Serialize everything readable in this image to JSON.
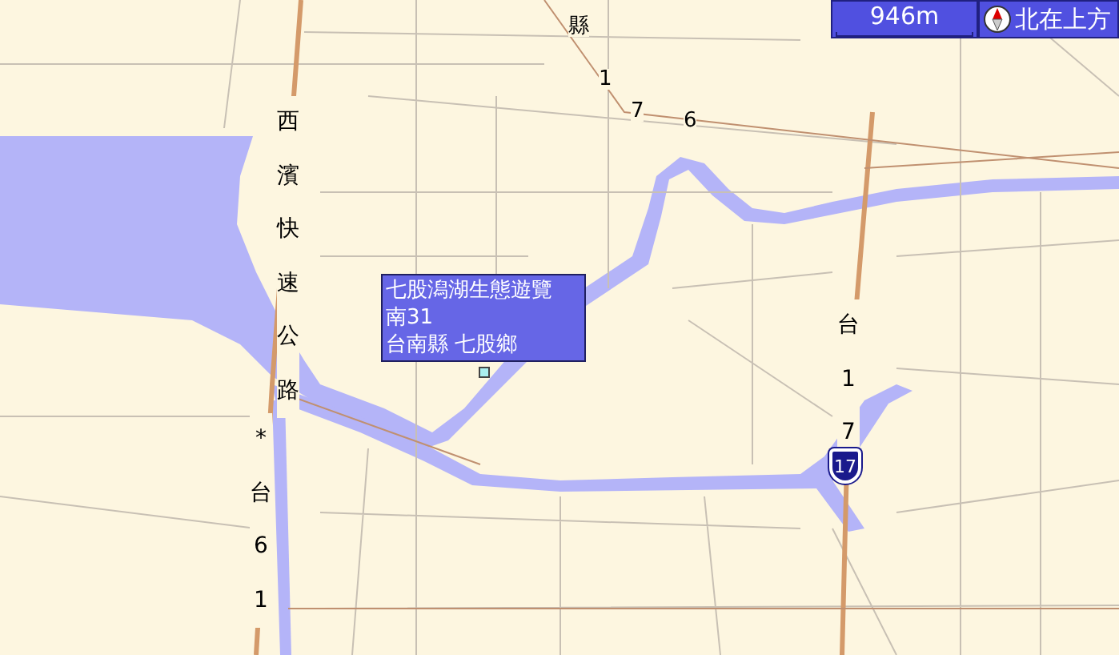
{
  "scale": {
    "distance": "946m"
  },
  "orientation": {
    "label": "北在上方"
  },
  "poi_card": {
    "lines": [
      "七股潟湖生態遊覽",
      "南31",
      "台南縣 七股鄉"
    ]
  },
  "map_labels": [
    {
      "kind": "vertical",
      "text": "西濱快速公路"
    },
    {
      "kind": "vertical",
      "text": "*台61"
    },
    {
      "kind": "text",
      "text": "縣"
    },
    {
      "kind": "text",
      "text": "1"
    },
    {
      "kind": "text",
      "text": "7"
    },
    {
      "kind": "text",
      "text": "6"
    },
    {
      "kind": "vertical",
      "text": "台17"
    },
    {
      "kind": "shield",
      "text": "17"
    }
  ]
}
